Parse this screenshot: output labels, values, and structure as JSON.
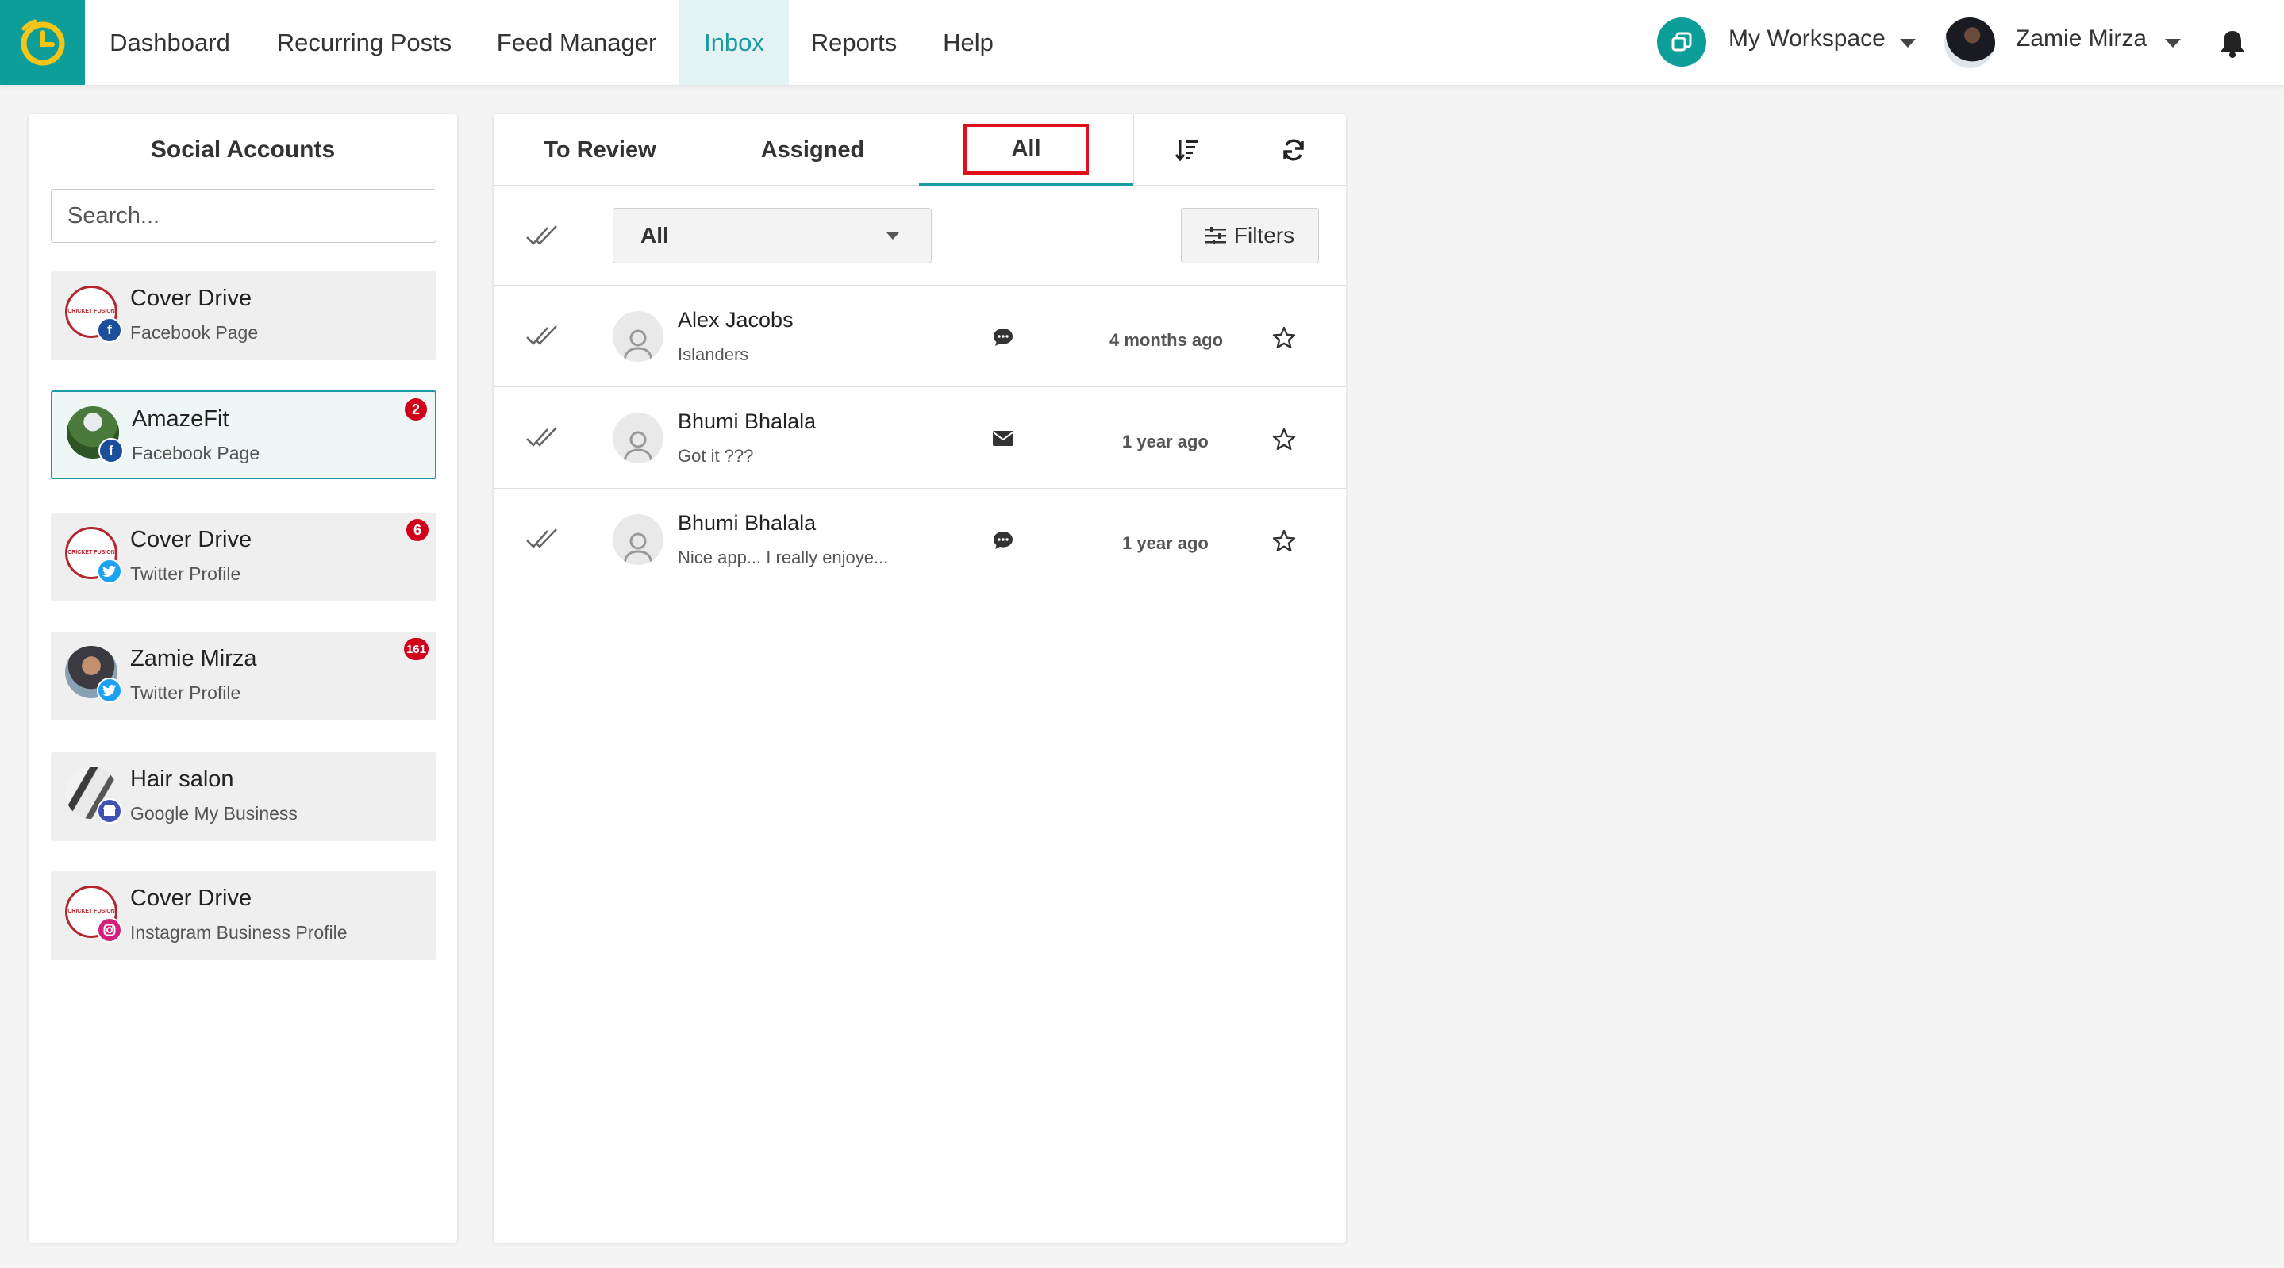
{
  "nav": {
    "items": [
      {
        "label": "Dashboard"
      },
      {
        "label": "Recurring Posts"
      },
      {
        "label": "Feed Manager"
      },
      {
        "label": "Inbox",
        "active": true
      },
      {
        "label": "Reports"
      },
      {
        "label": "Help"
      }
    ],
    "workspace_label": "My Workspace",
    "user_name": "Zamie Mirza",
    "accent_color": "#0e9e9a"
  },
  "sidebar": {
    "title": "Social Accounts",
    "search_placeholder": "Search...",
    "accounts": [
      {
        "name": "Cover Drive",
        "type": "Facebook Page",
        "platform": "facebook",
        "badge": ""
      },
      {
        "name": "AmazeFit",
        "type": "Facebook Page",
        "platform": "facebook",
        "badge": "2",
        "selected": true
      },
      {
        "name": "Cover Drive",
        "type": "Twitter Profile",
        "platform": "twitter",
        "badge": "6"
      },
      {
        "name": "Zamie Mirza",
        "type": "Twitter Profile",
        "platform": "twitter",
        "badge": "161"
      },
      {
        "name": "Hair salon",
        "type": "Google My Business",
        "platform": "google-my-business",
        "badge": ""
      },
      {
        "name": "Cover Drive",
        "type": "Instagram Business Profile",
        "platform": "instagram",
        "badge": ""
      }
    ],
    "avatar_logo_text": "CRICKET FUSION"
  },
  "inbox": {
    "tabs": [
      {
        "label": "To Review"
      },
      {
        "label": "Assigned"
      },
      {
        "label": "All",
        "active": true
      }
    ],
    "filter_select_value": "All",
    "filters_label": "Filters",
    "messages": [
      {
        "name": "Alex Jacobs",
        "snippet": "Islanders",
        "type_icon": "comment-icon",
        "time": "4 months ago"
      },
      {
        "name": "Bhumi Bhalala",
        "snippet": "Got it ???",
        "type_icon": "envelope-icon",
        "time": "1 year ago"
      },
      {
        "name": "Bhumi Bhalala",
        "snippet": "Nice app... I really enjoye...",
        "type_icon": "comment-icon",
        "time": "1 year ago"
      }
    ]
  }
}
